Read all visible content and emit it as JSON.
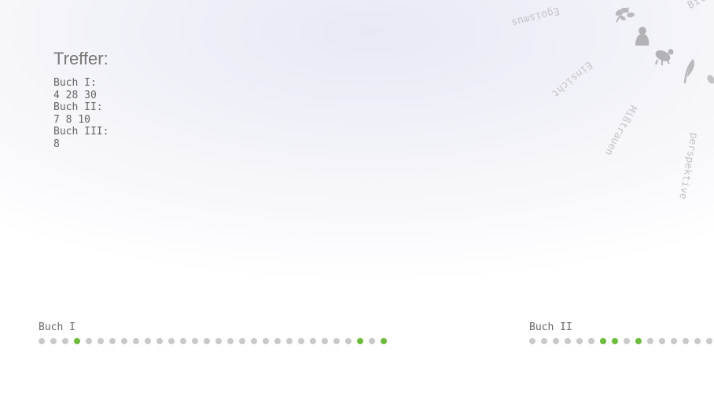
{
  "results": {
    "title": "Treffer:",
    "lines": [
      "Buch I:",
      "4 28 30",
      "Buch II:",
      "7 8 10",
      "Buch III:",
      "8"
    ]
  },
  "radial_words": [
    "Egoismus",
    "Einsicht",
    "Mißtrauen",
    "perspektive",
    "Bild"
  ],
  "radial_icons": [
    "leaf-icon",
    "person-icon",
    "animal-icon",
    "quill-icon"
  ],
  "books": [
    {
      "label": "Buch I",
      "dots": 30,
      "hits": [
        4,
        28,
        30
      ]
    },
    {
      "label": "Buch II",
      "dots": 16,
      "hits": [
        7,
        8,
        10
      ]
    }
  ],
  "colors": {
    "hit": "#6dbb3b",
    "dot": "#c9c9c9"
  }
}
